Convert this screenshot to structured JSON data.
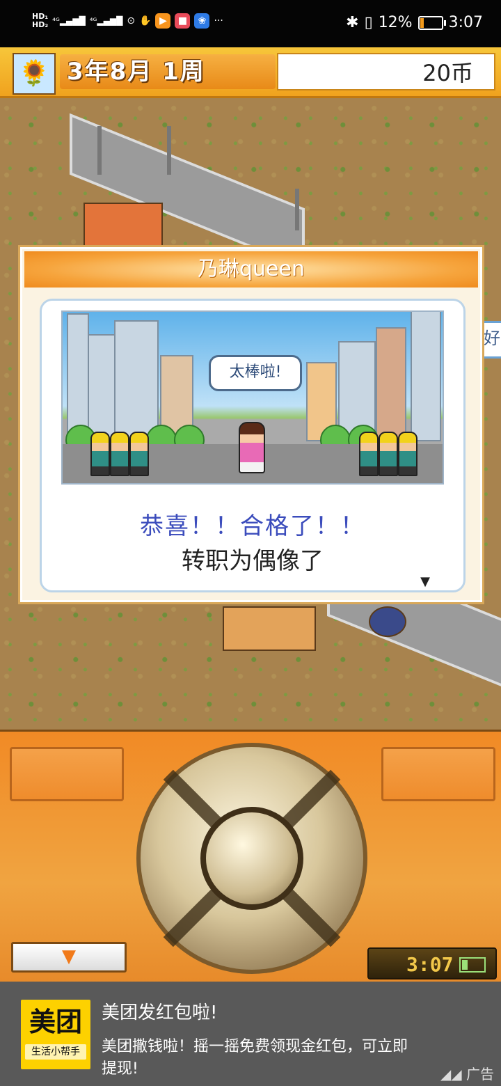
{
  "status_bar": {
    "time": "3:07",
    "battery": "12%",
    "more": "···"
  },
  "game": {
    "date": "3年8月 1周",
    "coins": "20币",
    "map_bubble": "你好"
  },
  "dialog": {
    "title": "乃琳queen",
    "scene_bubble": "太棒啦!",
    "message_1": "恭喜！！合格了！！",
    "message_2": "转职为偶像了"
  },
  "controls": {
    "clock": "3:07"
  },
  "ad": {
    "brand": "美团",
    "brand_sub": "生活小帮手",
    "title": "美团发红包啦!",
    "body": "美团撒钱啦！摇一摇免费领现金红包，可立即提现!",
    "tag": "广告"
  },
  "colors": {
    "accent_orange": "#f0a21e",
    "message_blue": "#3b4cbc"
  }
}
